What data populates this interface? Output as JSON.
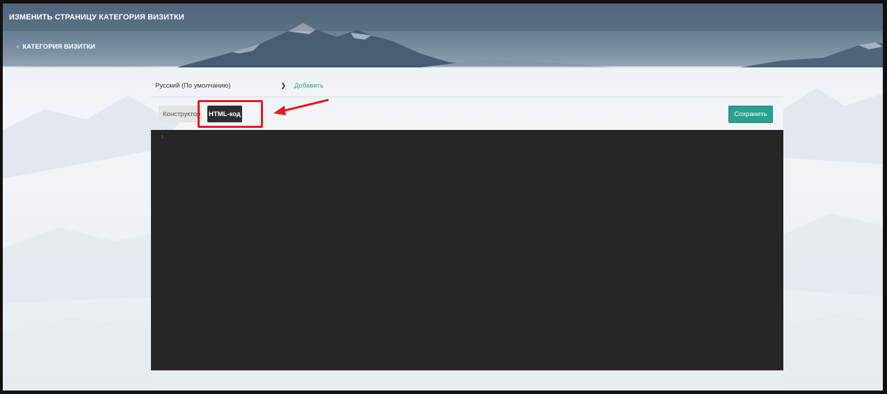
{
  "header": {
    "title": "ИЗМЕНИТЬ СТРАНИЦУ КАТЕГОРИЯ ВИЗИТКИ",
    "breadcrumb": "КАТЕГОРИЯ ВИЗИТКИ",
    "back_icon": "chevron-left-icon"
  },
  "language": {
    "selected": "Русский (По умолчанию)",
    "add_label": "Добавить"
  },
  "tabs": [
    {
      "label": "Конструктор",
      "active": false
    },
    {
      "label": "HTML-код",
      "active": true
    }
  ],
  "toolbar": {
    "save_label": "Сохранить"
  },
  "editor": {
    "line_numbers": [
      "1"
    ]
  },
  "colors": {
    "accent": "#2aa08e",
    "highlight": "#e6181e",
    "editor_bg": "#262626",
    "active_tab": "#2a2d31"
  }
}
